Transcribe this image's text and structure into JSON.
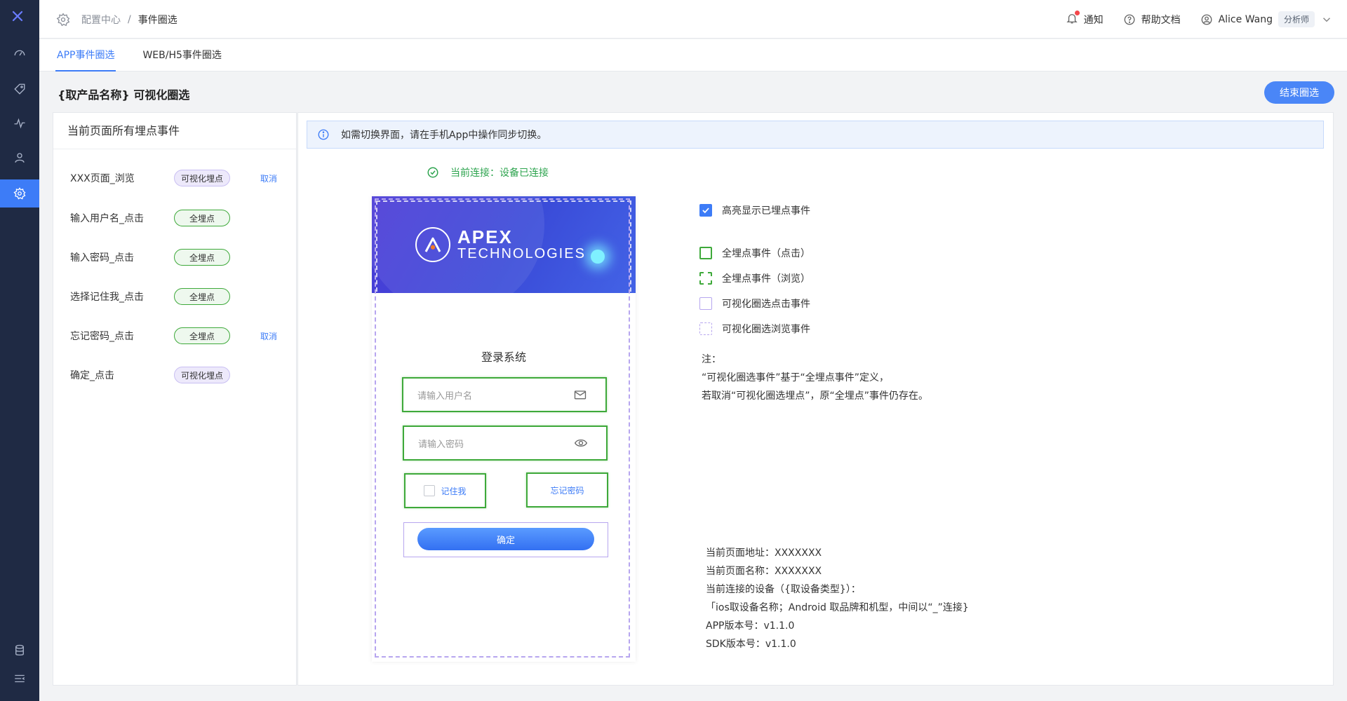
{
  "rail": {
    "items": [
      "dashboard-icon",
      "tag-icon",
      "activity-icon",
      "user-profile-icon",
      "settings-icon"
    ],
    "active": "settings-icon",
    "bottom": [
      "database-icon",
      "collapse-menu-icon"
    ]
  },
  "header": {
    "breadcrumb": {
      "parent": "配置中心",
      "sep": "/",
      "current": "事件圈选"
    },
    "notify": "通知",
    "help": "帮助文档",
    "user": "Alice Wang",
    "role": "分析师"
  },
  "tabs": [
    {
      "label": "APP事件圈选",
      "active": true
    },
    {
      "label": "WEB/H5事件圈选",
      "active": false
    }
  ],
  "page": {
    "title": "{取产品名称} 可视化圈选",
    "end_button": "结束圈选"
  },
  "left_panel": {
    "title": "当前页面所有埋点事件",
    "events": [
      {
        "name": "XXX页面_浏览",
        "tag": "可视化埋点",
        "tag_type": "vis",
        "action": "取消"
      },
      {
        "name": "输入用户名_点击",
        "tag": "全埋点",
        "tag_type": "full",
        "action": ""
      },
      {
        "name": "输入密码_点击",
        "tag": "全埋点",
        "tag_type": "full",
        "action": ""
      },
      {
        "name": "选择记住我_点击",
        "tag": "全埋点",
        "tag_type": "full",
        "action": ""
      },
      {
        "name": "忘记密码_点击",
        "tag": "全埋点",
        "tag_type": "full",
        "action": "取消"
      },
      {
        "name": "确定_点击",
        "tag": "可视化埋点",
        "tag_type": "vis",
        "action": ""
      }
    ]
  },
  "info_bar": "如需切换界面，请在手机App中操作同步切换。",
  "connection": "当前连接：设备已连接",
  "phone": {
    "brand_line1": "APEX",
    "brand_line2": "TECHNOLOGIES",
    "login_title": "登录系统",
    "username_placeholder": "请输入用户名",
    "password_placeholder": "请输入密码",
    "remember": "记住我",
    "forgot": "忘记密码",
    "ok": "确定"
  },
  "legend": {
    "highlight": {
      "label": "高亮显示已埋点事件",
      "checked": true
    },
    "items": [
      {
        "label": "全埋点事件（点击）",
        "style": "g-solid"
      },
      {
        "label": "全埋点事件（浏览）",
        "style": "g-dash"
      },
      {
        "label": "可视化圈选点击事件",
        "style": "p-solid"
      },
      {
        "label": "可视化圈选浏览事件",
        "style": "p-dash"
      }
    ]
  },
  "note": {
    "title": "注：",
    "line1": "“可视化圈选事件”基于“全埋点事件”定义，",
    "line2": "若取消“可视化圈选埋点”，原“全埋点”事件仍存在。"
  },
  "meta": {
    "page_url": "当前页面地址：XXXXXXX",
    "page_name": "当前页面名称：XXXXXXX",
    "device_label": "当前连接的设备（{取设备类型}）：",
    "device_value": "「ios取设备名称；Android 取品牌和机型，中间以“_”连接}",
    "app_version": "APP版本号：v1.1.0",
    "sdk_version": "SDK版本号：v1.1.0"
  },
  "colors": {
    "accent": "#3d7cf7",
    "rail_bg": "#1f2a44",
    "full_point": "#3ea93a",
    "visual_point": "#b7a6ef"
  }
}
